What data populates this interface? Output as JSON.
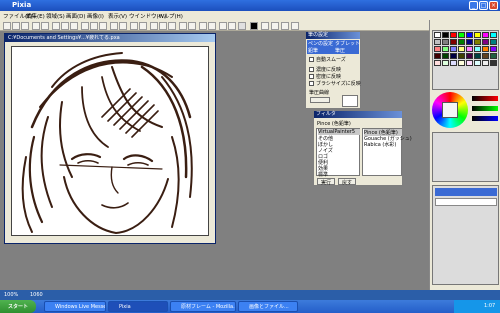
{
  "app": {
    "title": "Pixia"
  },
  "menu": [
    "ファイル(F)",
    "編集(E)",
    "領域(S)",
    "画面(D)",
    "画像(I)",
    "表示(V)",
    "ウインドウ(W)",
    "ヘルプ(H)"
  ],
  "canvas": {
    "title": "C:¥Documents and Settings¥...¥疲れてる.pxa"
  },
  "brush_panel": {
    "title": "筆の設定",
    "tabs": [
      "ペンの設定",
      "タブレット",
      "鉛筆",
      "筆圧"
    ],
    "auto_smooth": "自動スムーズ",
    "density_options": [
      "濃度に反映",
      "密度に反映",
      "ブラシサイズに反映"
    ],
    "pressure_label": "筆圧曲線"
  },
  "filter_panel": {
    "title": "フィルタ",
    "left_header": "Pince (色鉛筆)",
    "left_list": [
      "VirtualPainter5",
      "その他",
      "ぼかし",
      "ノイズ",
      "ロゴ",
      "便利",
      "効果",
      "標準"
    ],
    "right_list": [
      "Pince (色鉛筆)",
      "Gouache (ガッシュ)",
      "Rabica (水彩)"
    ],
    "run": "実行",
    "back": "戻す"
  },
  "statusbar": {
    "zoom": "100%",
    "info": "1060"
  },
  "taskbar": {
    "start": "スタート",
    "tasks": [
      "Windows Live Messen...",
      "Pixia",
      "原材フレーム - Mozilla...",
      "画像とファイル..."
    ],
    "clock": "1:07"
  }
}
